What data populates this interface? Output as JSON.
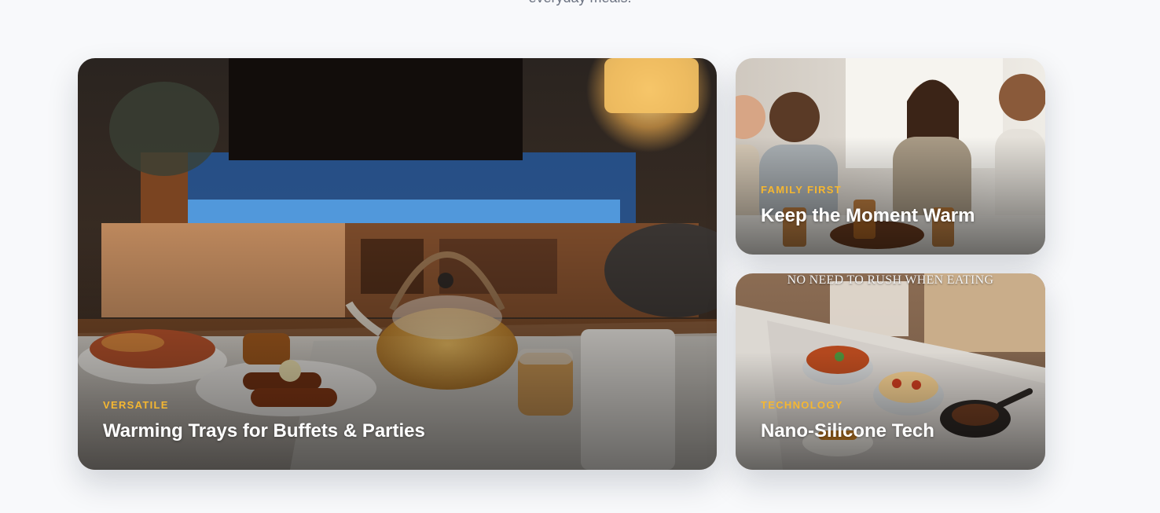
{
  "section": {
    "intro_text": "everyday meals."
  },
  "cards": [
    {
      "kicker": "VERSATILE",
      "title": "Warming Trays for Buffets & Parties",
      "image": "living-room-teapot-food-on-warming-tray"
    },
    {
      "kicker": "FAMILY FIRST",
      "title": "Keep the Moment Warm",
      "image": "friends-laughing-at-dinner-table"
    },
    {
      "kicker": "TECHNOLOGY",
      "title": "Nano-Silicone Tech",
      "image": "pots-and-pans-on-warming-mat",
      "image_caption": "NO NEED TO RUSH WHEN EATING"
    }
  ],
  "colors": {
    "page_bg": "#f8f9fb",
    "kicker": "#f5b731",
    "title": "#ffffff",
    "intro_text": "#6b7280"
  }
}
